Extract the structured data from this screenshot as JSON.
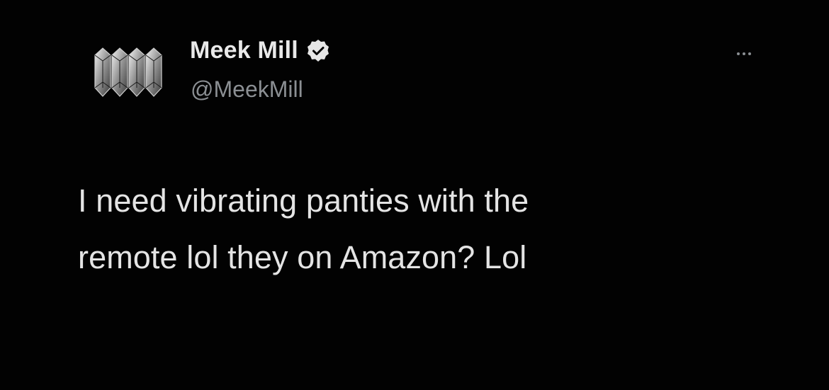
{
  "tweet": {
    "author": {
      "display_name": "Meek Mill",
      "handle": "@MeekMill",
      "verified": true,
      "verified_icon": "verified-badge-icon",
      "avatar_icon": "diamond-crystals-avatar"
    },
    "more_icon": "more-options-icon",
    "text_lines": [
      "I need vibrating panties with the",
      "remote lol they on Amazon? Lol"
    ]
  },
  "colors": {
    "background": "#020202",
    "name": "#e9e9e9",
    "handle": "#8b8f93",
    "text": "#e4e4e4"
  }
}
